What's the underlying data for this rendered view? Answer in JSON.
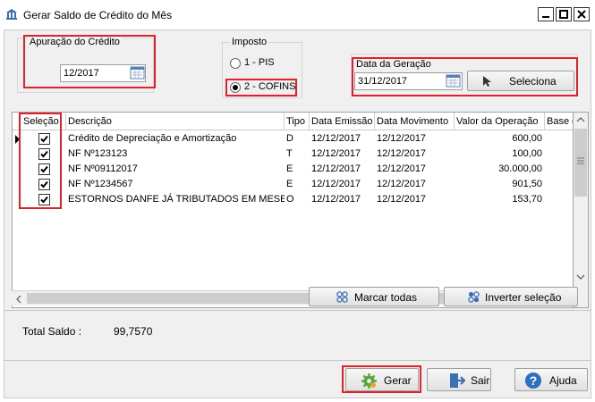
{
  "window": {
    "title": "Gerar Saldo de Crédito do Mês",
    "controls": [
      "minimize",
      "maximize",
      "close"
    ]
  },
  "apuracao": {
    "group_title": "Apuração do Crédito",
    "value": "12/2017"
  },
  "imposto": {
    "group_title": "Imposto",
    "options": [
      {
        "label": "1 - PIS",
        "selected": false
      },
      {
        "label": "2 - COFINS",
        "selected": true
      }
    ]
  },
  "data_geracao": {
    "group_title": "Data da Geração",
    "value": "31/12/2017",
    "seleciona_label": "Seleciona"
  },
  "grid": {
    "columns": [
      "Seleção",
      "Descrição",
      "Tipo",
      "Data Emissão",
      "Data Movimento",
      "Valor da Operação",
      "Base c"
    ],
    "rows": [
      {
        "selected": true,
        "descricao": "Crédito de Depreciação e Amortização",
        "tipo": "D",
        "data_emissao": "12/12/2017",
        "data_movimento": "12/12/2017",
        "valor": "600,00",
        "current": true
      },
      {
        "selected": true,
        "descricao": "NF Nº123123",
        "tipo": "T",
        "data_emissao": "12/12/2017",
        "data_movimento": "12/12/2017",
        "valor": "100,00",
        "current": false
      },
      {
        "selected": true,
        "descricao": "NF Nº09112017",
        "tipo": "E",
        "data_emissao": "12/12/2017",
        "data_movimento": "12/12/2017",
        "valor": "30.000,00",
        "current": false
      },
      {
        "selected": true,
        "descricao": "NF Nº1234567",
        "tipo": "E",
        "data_emissao": "12/12/2017",
        "data_movimento": "12/12/2017",
        "valor": "901,50",
        "current": false
      },
      {
        "selected": true,
        "descricao": "ESTORNOS DANFE JÁ TRIBUTADOS EM MESES AI",
        "tipo": "O",
        "data_emissao": "12/12/2017",
        "data_movimento": "12/12/2017",
        "valor": "153,70",
        "current": false
      }
    ]
  },
  "actions": {
    "marcar_todas": "Marcar todas",
    "inverter_selecao": "Inverter seleção"
  },
  "total": {
    "label": "Total Saldo :",
    "value": "99,7570"
  },
  "footer": {
    "gerar": "Gerar",
    "sair": "Sair",
    "ajuda": "Ajuda"
  },
  "colors": {
    "highlight_red": "#e0202a",
    "window_bg": "#f0f0f0"
  }
}
